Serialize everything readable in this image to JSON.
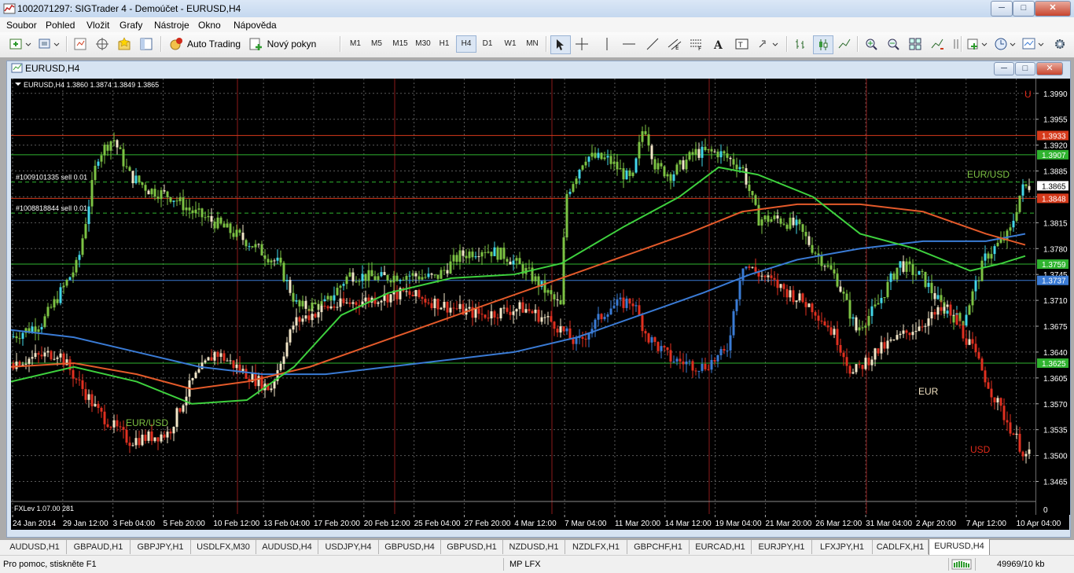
{
  "window": {
    "title": "1002071297: SIGTrader 4 - Demoúčet - EURUSD,H4",
    "minimize": "─",
    "maximize": "□",
    "close": "✕"
  },
  "menu": [
    "Soubor",
    "Pohled",
    "Vložit",
    "Grafy",
    "Nástroje",
    "Okno",
    "Nápověda"
  ],
  "toolbar": {
    "auto_trading": "Auto Trading",
    "new_order": "Nový pokyn",
    "timeframes": [
      "M1",
      "M5",
      "M15",
      "M30",
      "H1",
      "H4",
      "D1",
      "W1",
      "MN"
    ],
    "active_timeframe": "H4"
  },
  "chart_window": {
    "title": "EURUSD,H4",
    "minimize": "─",
    "maximize": "□",
    "close": "✕"
  },
  "chart_data": {
    "type": "candlestick",
    "symbol_info": "EURUSD,H4  1.3860 1.3874 1.3849 1.3865",
    "ohlc": {
      "open": 1.386,
      "high": 1.3874,
      "low": 1.3849,
      "close": 1.3865
    },
    "ylim": [
      1.344,
      1.401
    ],
    "y_ticks": [
      1.399,
      1.3955,
      1.392,
      1.3885,
      1.385,
      1.3815,
      1.378,
      1.3745,
      1.371,
      1.3675,
      1.364,
      1.3605,
      1.357,
      1.3535,
      1.35,
      1.3465
    ],
    "y_tick_labels": [
      "1.3990",
      "1.3955",
      "1.3920",
      "1.3885",
      "1.3850",
      "1.3815",
      "1.3780",
      "1.3745",
      "1.3710",
      "1.3675",
      "1.3640",
      "1.3605",
      "1.3570",
      "1.3535",
      "1.3500",
      "1.3465"
    ],
    "x_labels": [
      "24 Jan 2014",
      "29 Jan 12:00",
      "3 Feb 04:00",
      "5 Feb 20:00",
      "10 Feb 12:00",
      "13 Feb 04:00",
      "17 Feb 20:00",
      "20 Feb 12:00",
      "25 Feb 04:00",
      "27 Feb 20:00",
      "4 Mar 12:00",
      "7 Mar 04:00",
      "11 Mar 20:00",
      "14 Mar 12:00",
      "19 Mar 04:00",
      "21 Mar 20:00",
      "26 Mar 12:00",
      "31 Mar 04:00",
      "2 Apr 20:00",
      "7 Apr 12:00",
      "10 Apr 04:00"
    ],
    "price_levels": [
      {
        "value": 1.3933,
        "label": "1.3933",
        "color": "#d53a1b",
        "style": "solid"
      },
      {
        "value": 1.3907,
        "label": "1.3907",
        "color": "#2fb32f",
        "style": "solid"
      },
      {
        "value": 1.3865,
        "label": "1.3865",
        "color": "#ffffff",
        "style": "none"
      },
      {
        "value": 1.3848,
        "label": "1.3848",
        "color": "#d53a1b",
        "style": "solid"
      },
      {
        "value": 1.3759,
        "label": "1.3759",
        "color": "#2fb32f",
        "style": "solid"
      },
      {
        "value": 1.3737,
        "label": "1.3737",
        "color": "#3a7bd5",
        "style": "solid"
      },
      {
        "value": 1.3625,
        "label": "1.3625",
        "color": "#2fb32f",
        "style": "solid"
      }
    ],
    "trade_lines": [
      {
        "value": 1.387,
        "label": "#1009101335 sell 0.01"
      },
      {
        "value": 1.3828,
        "label": "#1008818844 sell 0.01"
      }
    ],
    "annotations": [
      {
        "text": "EUR/USD",
        "color": "#7cc243"
      },
      {
        "text": "EUR/USD",
        "color": "#7cc243"
      },
      {
        "text": "EUR",
        "color": "#f0e0c0"
      },
      {
        "text": "USD",
        "color": "#e02a1a"
      },
      {
        "text": "U",
        "color": "#e02a1a"
      }
    ],
    "indicator_label": "FXLev 1.07.00 281",
    "indicator_scale_label": "0",
    "series_colors": {
      "eur_up": "#42d6e8",
      "eur_up_alt": "#7cc243",
      "usd_down": "#e03020",
      "cream": "#f2e6c8",
      "blue_ma": "#3a7bd5",
      "red_ma": "#e45a2a",
      "green_ma": "#3ed13e"
    }
  },
  "symbol_tabs": [
    "AUDUSD,H1",
    "GBPAUD,H1",
    "GBPJPY,H1",
    "USDLFX,M30",
    "AUDUSD,H4",
    "USDJPY,H4",
    "GBPUSD,H4",
    "GBPUSD,H1",
    "NZDUSD,H1",
    "NZDLFX,H1",
    "GBPCHF,H1",
    "EURCAD,H1",
    "EURJPY,H1",
    "LFXJPY,H1",
    "CADLFX,H1",
    "EURUSD,H4"
  ],
  "active_tab": "EURUSD,H4",
  "status": {
    "help": "Pro pomoc, stiskněte F1",
    "profile": "MP LFX",
    "traffic": "49969/10 kb"
  }
}
